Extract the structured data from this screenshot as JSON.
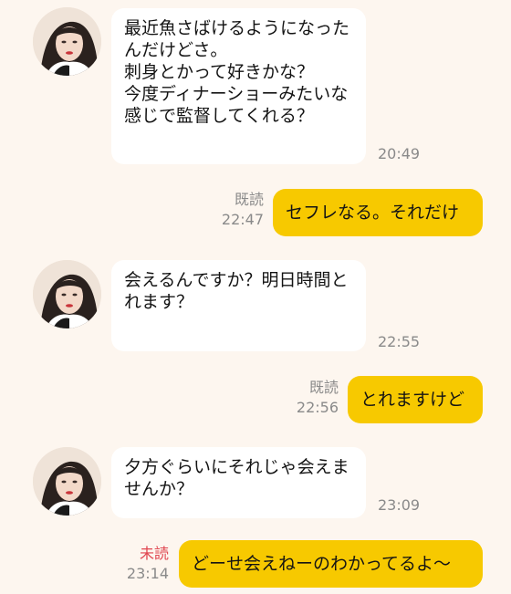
{
  "messages": [
    {
      "side": "in",
      "text": "最近魚さばけるようになったんだけどさ。\n刺身とかって好きかな？\n今度ディナーショーみたいな感じで監督してくれる？",
      "time": "20:49"
    },
    {
      "side": "out",
      "status": "既読",
      "time": "22:47",
      "text": "セフレなる。それだけ"
    },
    {
      "side": "in",
      "text": "会えるんですか？明日時間とれます？",
      "time": "22:55"
    },
    {
      "side": "out",
      "status": "既読",
      "time": "22:56",
      "text": "とれますけど"
    },
    {
      "side": "in",
      "text": "夕方ぐらいにそれじゃ会えませんか？",
      "time": "23:09"
    },
    {
      "side": "out",
      "status": "未読",
      "time": "23:14",
      "text": "どーせ会えねーのわかってるよ〜"
    }
  ],
  "colors": {
    "background": "#fdf6ef",
    "incoming_bubble": "#ffffff",
    "outgoing_bubble": "#f7c900",
    "unread_status": "#e0454f",
    "time": "#8a8a8a"
  },
  "icons": {
    "avatar": "profile-photo"
  }
}
